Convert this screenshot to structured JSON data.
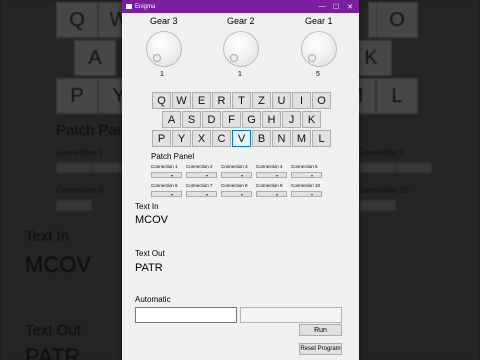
{
  "background": {
    "keys_row1": [
      "Q",
      "W",
      "E",
      "R",
      "T",
      "Z",
      "U",
      "I",
      "O"
    ],
    "keys_row2": [
      "A",
      "S",
      "D",
      "F",
      "G",
      "H",
      "J",
      "K"
    ],
    "keys_row3": [
      "P",
      "Y",
      "X",
      "C",
      "V",
      "B",
      "N",
      "M",
      "L"
    ],
    "patch_panel": "Patch Panel",
    "connection_1": "Connection 1",
    "connection_5": "Connection 5",
    "connection_6": "Connection 6",
    "connection_10": "Connection 10",
    "text_in": "Text In",
    "text_in_value": "MCOV",
    "text_out": "Text Out",
    "text_out_value": "PATR"
  },
  "window": {
    "title": "Enigma",
    "minimize": "—",
    "maximize": "☐",
    "close": "✕"
  },
  "gears": [
    {
      "label": "Gear 3",
      "value": "1"
    },
    {
      "label": "Gear 2",
      "value": "1"
    },
    {
      "label": "Gear 1",
      "value": "5"
    }
  ],
  "keyboard": {
    "row1": [
      "Q",
      "W",
      "E",
      "R",
      "T",
      "Z",
      "U",
      "I",
      "O"
    ],
    "row2": [
      "A",
      "S",
      "D",
      "F",
      "G",
      "H",
      "J",
      "K"
    ],
    "row3": [
      "P",
      "Y",
      "X",
      "C",
      "V",
      "B",
      "N",
      "M",
      "L"
    ],
    "active_key": "V"
  },
  "patch_panel": {
    "title": "Patch Panel",
    "connections": [
      "Connection 1",
      "Connection 2",
      "Connection 3",
      "Connection 4",
      "Connection 5",
      "Connection 6",
      "Connection 7",
      "Connection 8",
      "Connection 9",
      "Connection 10"
    ],
    "dropdown_glyph": "▾"
  },
  "text_in": {
    "label": "Text In",
    "value": "MCOV"
  },
  "text_out": {
    "label": "Text Out",
    "value": "PATR"
  },
  "automatic": {
    "label": "Automatic",
    "input_value": "",
    "output_value": "",
    "run_label": "Run",
    "reset_label": "Reset Program"
  },
  "colors": {
    "titlebar": "#7a1fa2",
    "window_bg": "#f0f0f0",
    "active_key_border": "#0078d7"
  }
}
